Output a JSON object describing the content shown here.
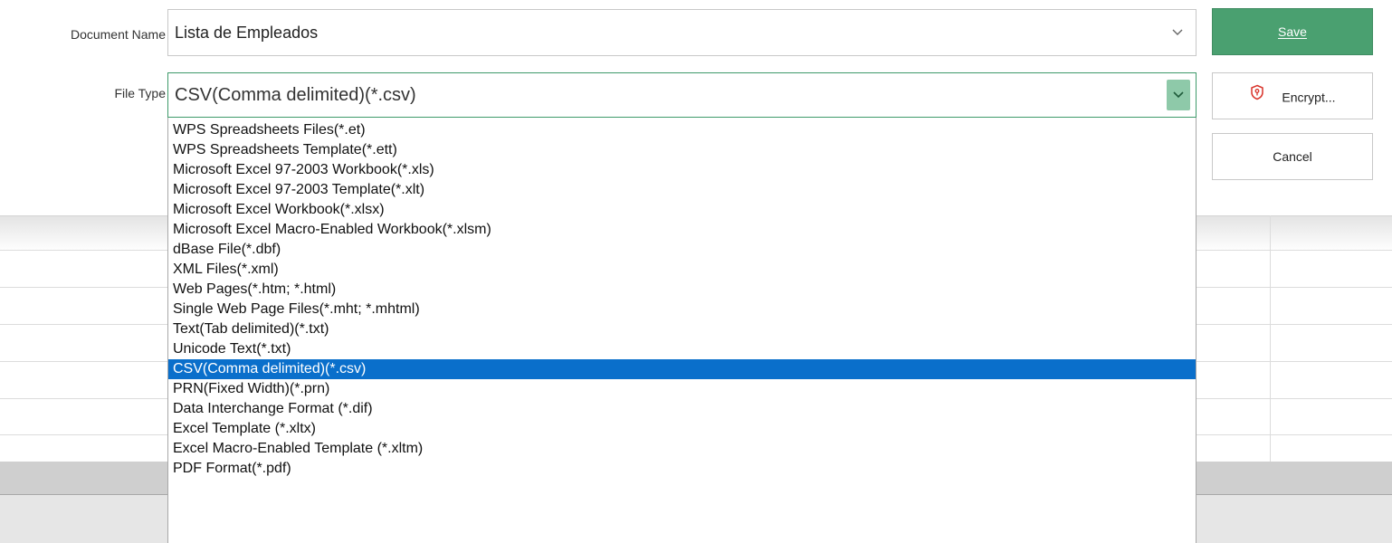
{
  "form": {
    "document_name_label": "Document Name",
    "document_name_value": "Lista de Empleados",
    "file_type_label": "File Type",
    "file_type_value": "CSV(Comma delimited)(*.csv)"
  },
  "buttons": {
    "save_label": "Save",
    "encrypt_label": "Encrypt...",
    "cancel_label": "Cancel"
  },
  "icons": {
    "document_name_dropdown": "chevron-down-icon",
    "file_type_dropdown": "chevron-down-icon",
    "encrypt": "shield-lock-icon"
  },
  "colors": {
    "save_button": "#4aa070",
    "selection": "#0a6fcb",
    "encrypt_icon": "#d9342b",
    "focus_border": "#3e9a6a"
  },
  "file_type_options": [
    "WPS Spreadsheets Files(*.et)",
    "WPS Spreadsheets Template(*.ett)",
    "Microsoft Excel 97-2003 Workbook(*.xls)",
    "Microsoft Excel 97-2003 Template(*.xlt)",
    "Microsoft Excel Workbook(*.xlsx)",
    "Microsoft Excel Macro-Enabled Workbook(*.xlsm)",
    "dBase File(*.dbf)",
    "XML Files(*.xml)",
    "Web Pages(*.htm; *.html)",
    "Single Web Page Files(*.mht; *.mhtml)",
    "Text(Tab delimited)(*.txt)",
    "Unicode Text(*.txt)",
    "CSV(Comma delimited)(*.csv)",
    "PRN(Fixed Width)(*.prn)",
    "Data Interchange Format (*.dif)",
    "Excel Template (*.xltx)",
    "Excel Macro-Enabled Template (*.xltm)",
    "PDF Format(*.pdf)"
  ],
  "selected_option": "CSV(Comma delimited)(*.csv)"
}
